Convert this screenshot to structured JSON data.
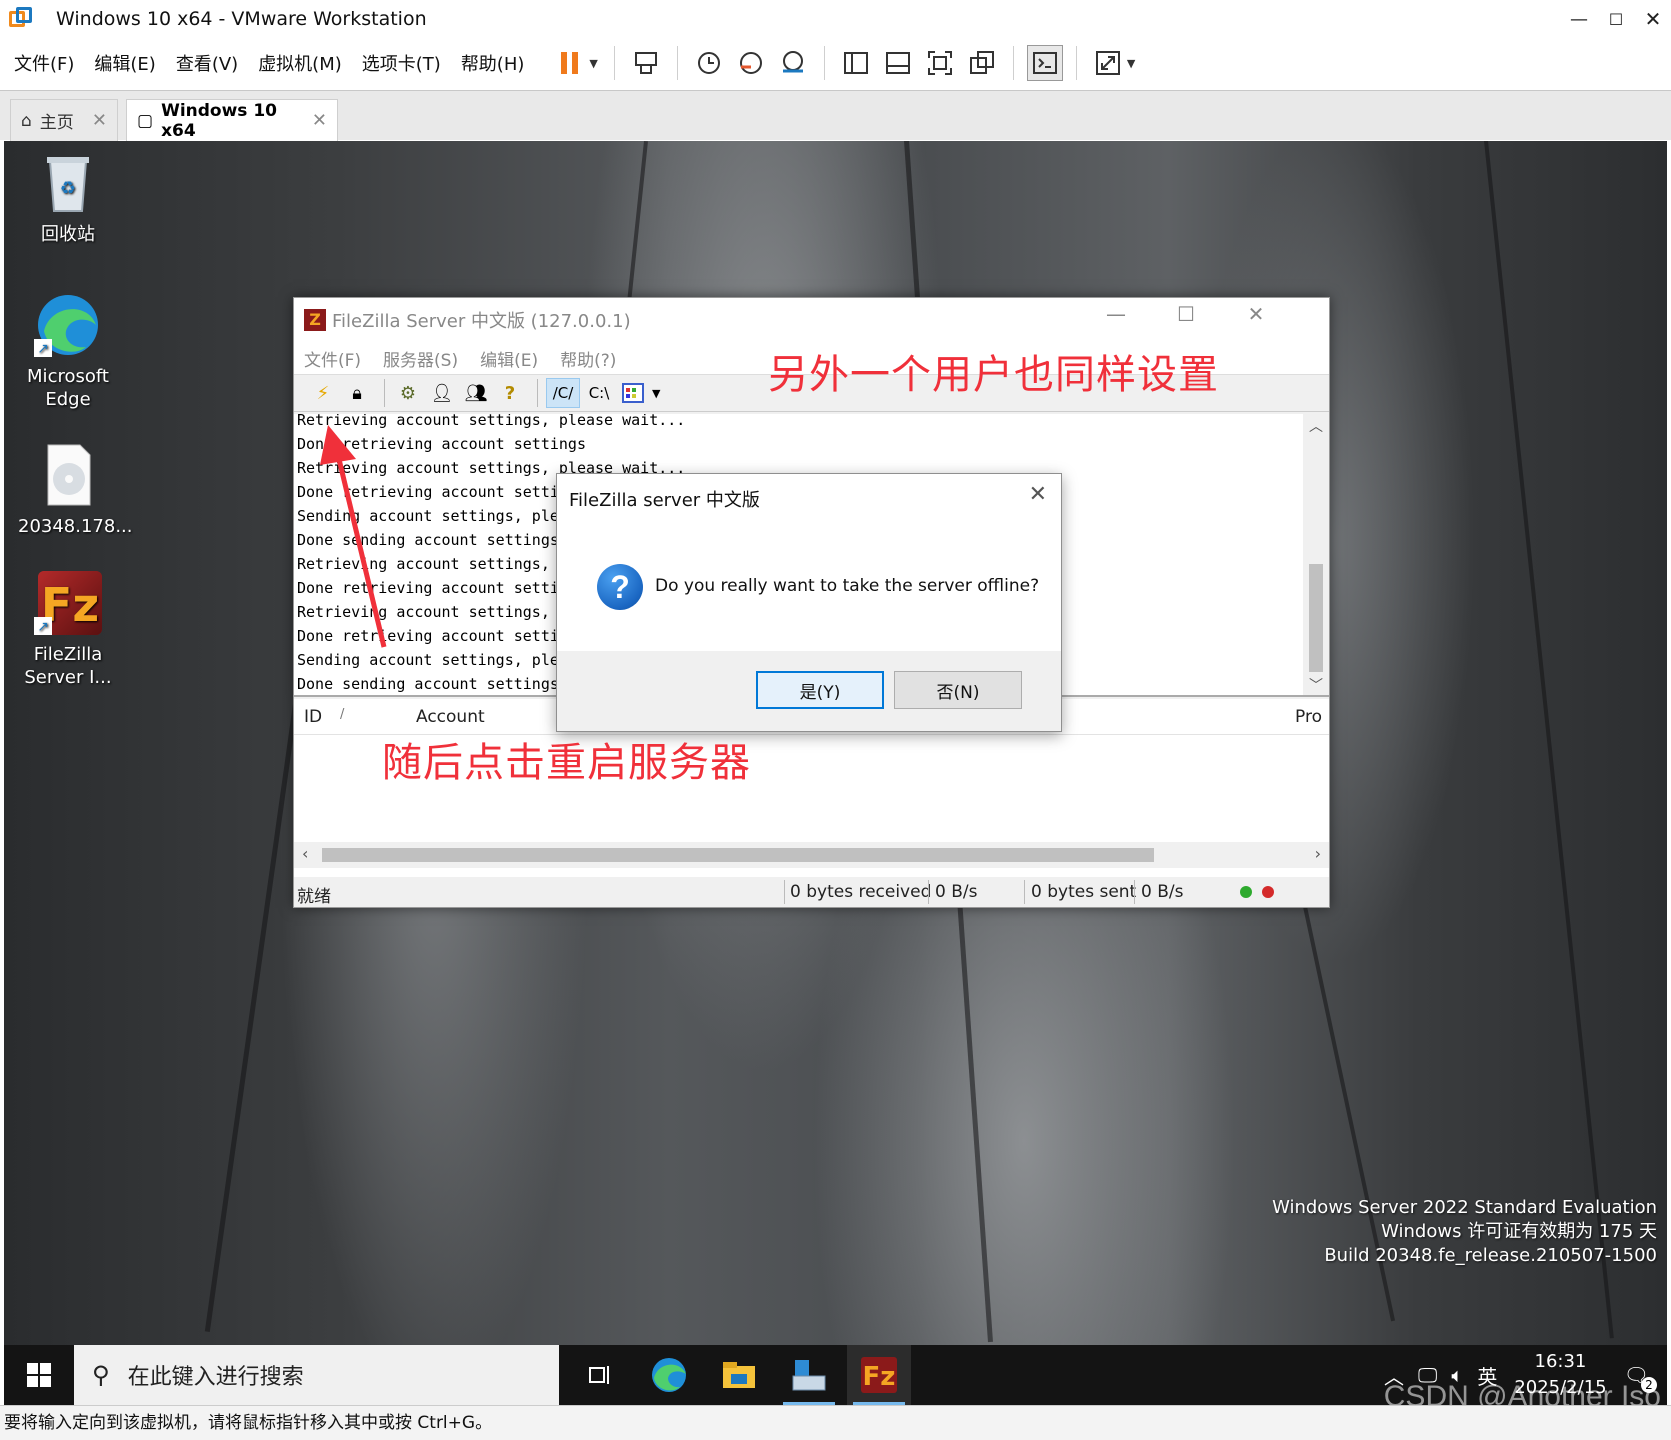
{
  "vm": {
    "title": "Windows 10 x64 - VMware Workstation",
    "menus": [
      "文件(F)",
      "编辑(E)",
      "查看(V)",
      "虚拟机(M)",
      "选项卡(T)",
      "帮助(H)"
    ],
    "tabs": [
      {
        "label": "主页",
        "active": false
      },
      {
        "label": "Windows 10 x64",
        "active": true
      }
    ],
    "status_text": "要将输入定向到该虚拟机，请将鼠标指针移入其中或按 Ctrl+G。",
    "colors": {
      "pause": "#f07a1c",
      "accent": "#1c79c0"
    }
  },
  "desktop": {
    "icons": [
      {
        "label_line1": "回收站",
        "label_line2": "",
        "icon": "recycle-bin-icon"
      },
      {
        "label_line1": "Microsoft",
        "label_line2": "Edge",
        "icon": "edge-icon"
      },
      {
        "label_line1": "20348.178...",
        "label_line2": "",
        "icon": "disc-image-icon"
      },
      {
        "label_line1": "FileZilla",
        "label_line2": "Server I...",
        "icon": "filezilla-icon"
      }
    ],
    "watermark": [
      "Windows Server 2022 Standard Evaluation",
      "Windows 许可证有效期为 175 天",
      "Build 20348.fe_release.210507-1500"
    ]
  },
  "filezilla": {
    "title": "FileZilla Server 中文版 (127.0.0.1)",
    "menus": [
      "文件(F)",
      "服务器(S)",
      "编辑(E)",
      "帮助(?)"
    ],
    "toolbar": {
      "path_c1": "/C/",
      "path_c2": "C:\\"
    },
    "log": [
      "Retrieving account settings, please wait...",
      "Done retrieving account settings",
      "Retrieving account settings, please wait...",
      "Done retrieving account setti",
      "Sending account settings, ple",
      "Done sending account settings",
      "Retrieving account settings,",
      "Done retrieving account setti",
      "Retrieving account settings,",
      "Done retrieving account setti",
      "Sending account settings, ple",
      "Done sending account settings"
    ],
    "columns": {
      "id": "ID",
      "sort": "/",
      "account": "Account",
      "pro": "Pro"
    },
    "status": {
      "ready": "就绪",
      "received": "0 bytes received",
      "recv_rate": "0 B/s",
      "sent": "0 bytes sent",
      "sent_rate": "0 B/s"
    }
  },
  "dialog": {
    "title": "FileZilla server 中文版",
    "message": "Do you really want to take the server offline?",
    "yes": "是(Y)",
    "no": "否(N)",
    "icon": "question-icon"
  },
  "annotations": {
    "top": "另外一个用户也同样设置",
    "bottom": "随后点击重启服务器",
    "color": "#f0303a"
  },
  "taskbar": {
    "search_placeholder": "在此键入进行搜索",
    "ime": "英",
    "time": "16:31",
    "date": "2025/2/15",
    "notifications": "2"
  },
  "credit": "CSDN @Another Iso"
}
